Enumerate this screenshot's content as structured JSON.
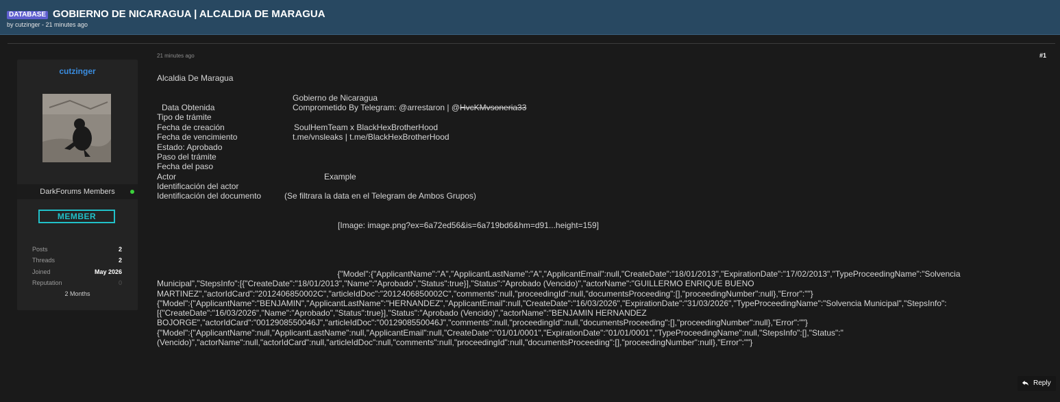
{
  "header": {
    "badge": "DATABASE",
    "title": "GOBIERNO DE NICARAGUA | ALCALDIA DE MARAGUA",
    "byline": "by cutzinger - 21 minutes ago"
  },
  "user": {
    "name": "cutzinger",
    "group": "DarkForums Members",
    "rank": "MEMBER",
    "stats": [
      {
        "label": "Posts",
        "value": "2"
      },
      {
        "label": "Threads",
        "value": "2"
      },
      {
        "label": "Joined",
        "value": "May 2026"
      },
      {
        "label": "Reputation",
        "value": "0"
      }
    ],
    "membership": "2 Months"
  },
  "post": {
    "time": "21 minutes ago",
    "number": "#1",
    "lines": {
      "l1": "Alcaldia De Maragua",
      "gov": "Gobierno de Nicaragua",
      "data_obtenida": "Data Obtenida",
      "comprometido": "Comprometido By Telegram: @arrestaron | @",
      "struck_handle": "HvcKMvsoneria33",
      "tipo": "Tipo de trámite",
      "fecha_creacion": "Fecha de creación",
      "team": "SoulHemTeam x BlackHexBrotherHood",
      "fecha_venc": "Fecha de vencimiento",
      "links": "t.me/vnsleaks | t.me/BlackHexBrotherHood",
      "estado": "Estado: Aprobado",
      "paso": "Paso del trámite",
      "fecha_paso": "Fecha del paso",
      "actor": "Actor",
      "example": "Example",
      "id_actor": "Identificación del actor",
      "id_doc": "Identificación del documento",
      "filtrara": "(Se filtrara la data en el Telegram de Ambos Grupos)",
      "image": "[Image: image.png?ex=6a72ed56&is=6a719bd6&hm=d91...height=159]"
    },
    "json_lines": [
      "                                                                               {\"Model\":{\"ApplicantName\":\"A\",\"ApplicantLastName\":\"A\",\"ApplicantEmail\":null,\"CreateDate\":\"18/01/2013\",\"ExpirationDate\":\"17/02/2013\",\"TypeProceedingName\":\"Solvencia",
      "Municipal\",\"StepsInfo\":[{\"CreateDate\":\"18/01/2013\",\"Name\":\"Aprobado\",\"Status\":true}],\"Status\":\"Aprobado (Vencido)\",\"actorName\":\"GUILLERMO ENRIQUE BUENO",
      "MARTINEZ\",\"actorIdCard\":\"2012406850002C\",\"articleIdDoc\":\"2012406850002C\",\"comments\":null,\"proceedingId\":null,\"documentsProceeding\":[],\"proceedingNumber\":null},\"Error\":\"\"}",
      "{\"Model\":{\"ApplicantName\":\"BENJAMIN\",\"ApplicantLastName\":\"HERNANDEZ\",\"ApplicantEmail\":null,\"CreateDate\":\"16/03/2026\",\"ExpirationDate\":\"31/03/2026\",\"TypeProceedingName\":\"Solvencia Municipal\",\"StepsInfo\":",
      "[{\"CreateDate\":\"16/03/2026\",\"Name\":\"Aprobado\",\"Status\":true}],\"Status\":\"Aprobado (Vencido)\",\"actorName\":\"BENJAMIN HERNANDEZ",
      "BOJORGE\",\"actorIdCard\":\"0012908550046J\",\"articleIdDoc\":\"0012908550046J\",\"comments\":null,\"proceedingId\":null,\"documentsProceeding\":[],\"proceedingNumber\":null},\"Error\":\"\"}",
      "{\"Model\":{\"ApplicantName\":null,\"ApplicantLastName\":null,\"ApplicantEmail\":null,\"CreateDate\":\"01/01/0001\",\"ExpirationDate\":\"01/01/0001\",\"TypeProceedingName\":null,\"StepsInfo\":[],\"Status\":\"",
      "(Vencido)\",\"actorName\":null,\"actorIdCard\":null,\"articleIdDoc\":null,\"comments\":null,\"proceedingId\":null,\"documentsProceeding\":[],\"proceedingNumber\":null},\"Error\":\"\"}"
    ]
  },
  "reply": {
    "label": "Reply",
    "icon": "reply-arrow-icon"
  },
  "colors": {
    "header_bg": "#284861",
    "badge_bg": "#5f5fcf",
    "username": "#3a8de0",
    "rank_badge": "#21c1c9",
    "online": "#3bd13b"
  }
}
